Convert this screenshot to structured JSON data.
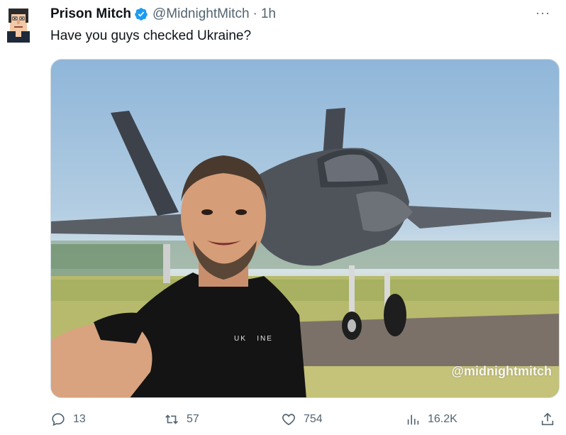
{
  "author": {
    "name": "Prison Mitch",
    "handle": "@MidnightMitch",
    "separator": "·",
    "time": "1h"
  },
  "tweet": {
    "text": "Have you guys checked Ukraine?"
  },
  "media": {
    "shirt_text": "UK   INE",
    "watermark": "@midnightmitch"
  },
  "actions": {
    "replies": "13",
    "retweets": "57",
    "likes": "754",
    "views": "16.2K"
  },
  "menu": {
    "more": "···"
  },
  "colors": {
    "verified": "#1d9bf0",
    "secondary_text": "#536471",
    "primary_text": "#0f1419"
  }
}
